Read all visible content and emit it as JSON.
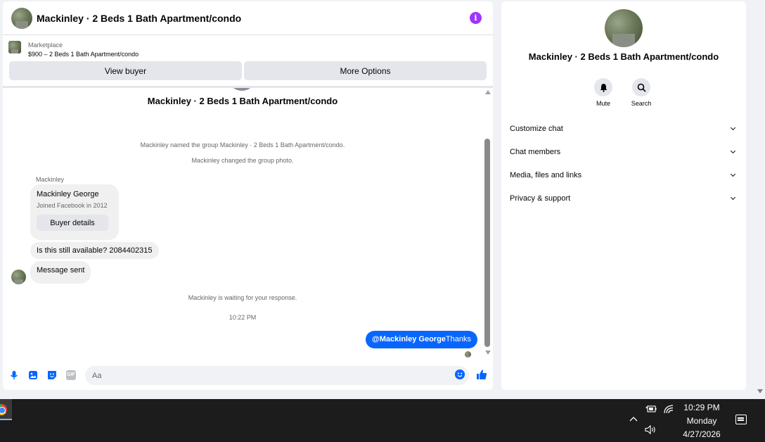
{
  "chat": {
    "title": "Mackinley · 2 Beds 1 Bath Apartment/condo",
    "info_icon": "i",
    "marketplace_label": "Marketplace",
    "listing": "$900 – 2 Beds 1 Bath Apartment/condo",
    "view_buyer": "View buyer",
    "more_options": "More Options"
  },
  "thread": {
    "group_name": "Mackinley · 2 Beds 1 Bath Apartment/condo",
    "system_messages": [
      "Mackinley named the group Mackinley · 2 Beds 1 Bath Apartment/condo.",
      "Mackinley changed the group photo.",
      "Mackinley is waiting for your response."
    ],
    "sender": "Mackinley",
    "card": {
      "name": "Mackinley George",
      "subtitle": "Joined Facebook in 2012",
      "button": "Buyer details"
    },
    "messages": [
      "Is this still available? 2084402315",
      "Message sent"
    ],
    "timestamp": "10:22 PM",
    "my_message": {
      "mention": "@Mackinley George",
      "text": "Thanks"
    }
  },
  "composer": {
    "placeholder": "Aa",
    "icons": [
      "microphone-icon",
      "photo-icon",
      "sticker-icon",
      "gif-icon",
      "emoji-icon",
      "thumbs-up-icon"
    ],
    "gif_label": "GIF"
  },
  "details": {
    "title": "Mackinley · 2 Beds 1 Bath Apartment/condo",
    "mute": "Mute",
    "search": "Search",
    "sections": [
      "Customize chat",
      "Chat members",
      "Media, files and links",
      "Privacy & support"
    ]
  },
  "taskbar": {
    "time": "10:29 PM",
    "day": "Monday",
    "date": "4/27/2026"
  },
  "colors": {
    "accent": "#0866ff",
    "info": "#a033ff",
    "taskbar": "#1c1c1c"
  }
}
